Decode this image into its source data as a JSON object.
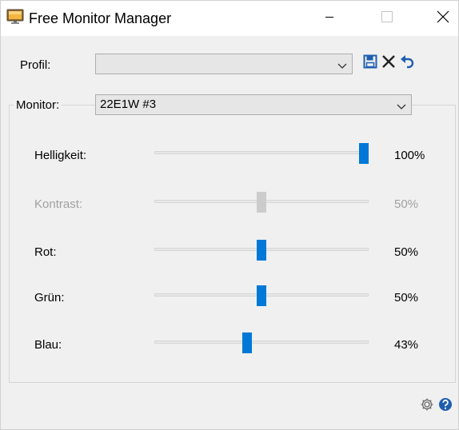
{
  "window": {
    "title": "Free Monitor Manager",
    "icons": {
      "app": "monitor-icon",
      "minimize": "minimize-icon",
      "maximize": "maximize-icon",
      "close": "close-icon"
    }
  },
  "profile": {
    "label": "Profil:",
    "selected": "",
    "toolbar_icons": [
      "save-icon",
      "delete-icon",
      "undo-icon"
    ]
  },
  "monitor": {
    "label": "Monitor:",
    "selected": "22E1W #3"
  },
  "sliders": [
    {
      "name": "brightness",
      "label": "Helligkeit:",
      "value": 100,
      "value_text": "100%",
      "enabled": true
    },
    {
      "name": "contrast",
      "label": "Kontrast:",
      "value": 50,
      "value_text": "50%",
      "enabled": false
    },
    {
      "name": "red",
      "label": "Rot:",
      "value": 50,
      "value_text": "50%",
      "enabled": true
    },
    {
      "name": "green",
      "label": "Grün:",
      "value": 50,
      "value_text": "50%",
      "enabled": true
    },
    {
      "name": "blue",
      "label": "Blau:",
      "value": 43,
      "value_text": "43%",
      "enabled": true
    }
  ],
  "footer": {
    "icons": [
      "settings-icon",
      "help-icon"
    ]
  },
  "colors": {
    "accent": "#0078d7",
    "disabled": "#cccccc",
    "icon_blue": "#1e5eb0"
  }
}
